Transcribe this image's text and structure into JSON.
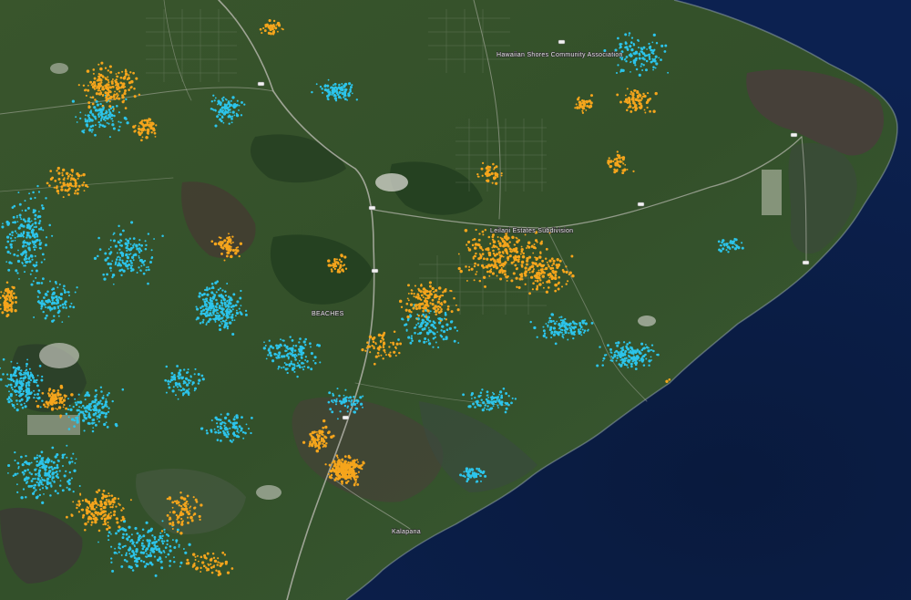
{
  "map": {
    "view": "satellite",
    "colors": {
      "ocean": "#0a1a3a",
      "ocean_deep": "#06122b",
      "land_green": "#3c5a2c",
      "land_dark": "#243f22",
      "lava_brown": "#4a3b35",
      "roads": "#b9b9b0",
      "orange_points": "#f5a51c",
      "cyan_points": "#2cc4ea"
    },
    "labels": [
      {
        "id": "hawaiian-shores",
        "text": "Hawaiian Shores Community Association"
      },
      {
        "id": "leilani-estates",
        "text": "Leilani Estates Subdivision"
      },
      {
        "id": "beaches",
        "text": "BEACHES"
      },
      {
        "id": "kalapana",
        "text": "Kalapana"
      }
    ]
  }
}
